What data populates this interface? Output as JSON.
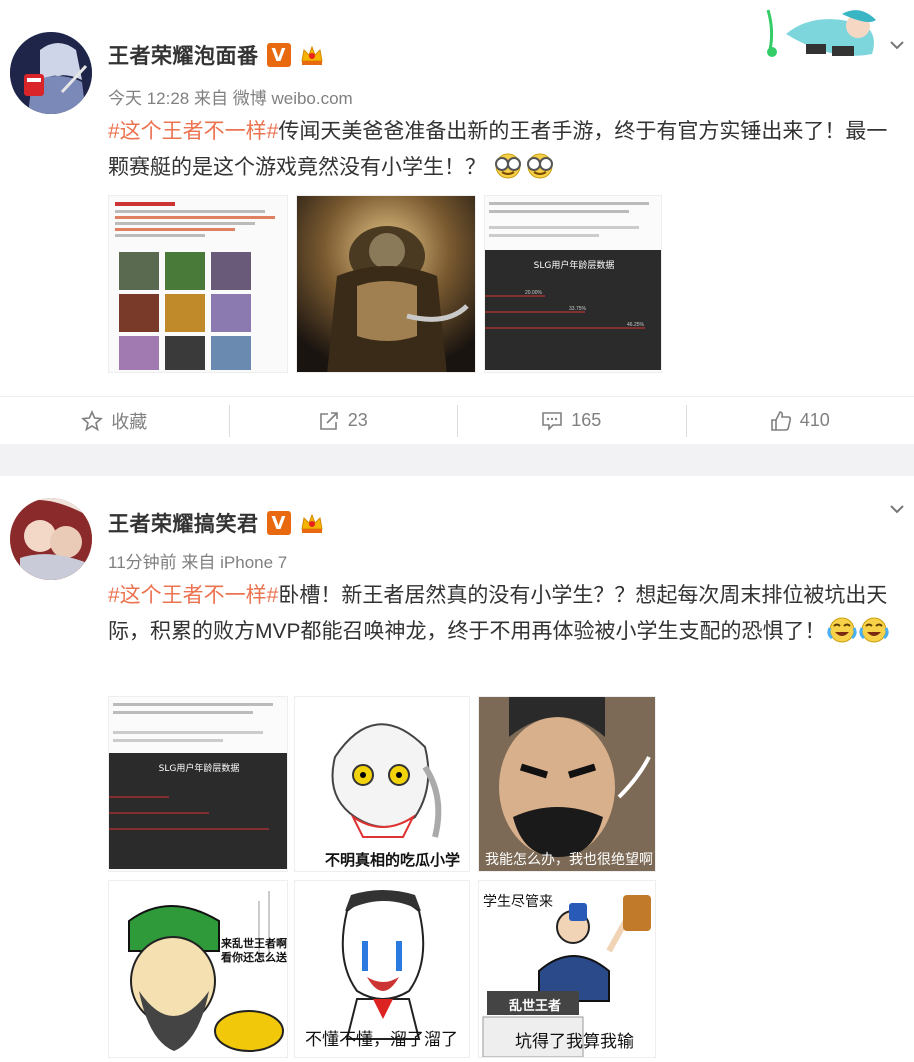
{
  "posts": [
    {
      "user_name": "王者荣耀泡面番",
      "verified_badge": "V",
      "time": "今天 12:28",
      "source_prefix": "来自",
      "source": "微博 weibo.com",
      "hashtag": "#这个王者不一样#",
      "text": "传闻天美爸爸准备出新的王者手游，终于有官方实锤出来了！最一颗赛艇的是这个游戏竟然没有小学生！？",
      "emojis": [
        "smile-glasses-emoji",
        "smile-glasses-emoji"
      ],
      "images": [
        {
          "name": "screenshot-weibo-grid-thumb"
        },
        {
          "name": "golden-armor-warrior-thumb"
        },
        {
          "name": "slg-chart-thumb",
          "chart_title": "SLG用户年龄层数据",
          "chart_labels": [
            "20.00%",
            "33.75%",
            "46.25%"
          ]
        }
      ],
      "actions": {
        "favorite_label": "收藏",
        "repost_count": "23",
        "comment_count": "165",
        "like_count": "410"
      }
    },
    {
      "user_name": "王者荣耀搞笑君",
      "verified_badge": "V",
      "time": "11分钟前",
      "source_prefix": "来自",
      "source": "iPhone 7",
      "hashtag": "#这个王者不一样#",
      "text": "卧槽！新王者居然真的没有小学生？？想起每次周末排位被坑出天际，积累的败方MVP都能召唤神龙，终于不用再体验被小学生支配的恐惧了！",
      "emojis": [
        "laugh-cry-emoji",
        "laugh-cry-emoji"
      ],
      "images": [
        {
          "name": "slg-chart-thumb",
          "chart_title": "SLG用户年龄层数据"
        },
        {
          "name": "meme-cartoon-thumb",
          "caption": "不明真相的吃瓜小学生"
        },
        {
          "name": "meme-face-thumb",
          "caption": "我能怎么办，我也很绝望啊"
        },
        {
          "name": "meme-general-thumb",
          "caption": "来乱世王者啊 看你还怎么送"
        },
        {
          "name": "meme-crying-thumb",
          "caption": "不懂不懂，溜了溜了"
        },
        {
          "name": "meme-podium-thumb",
          "caption_top": "学生尽管来",
          "sign": "乱世王者",
          "caption": "坑得了我算我输"
        }
      ]
    }
  ],
  "colors": {
    "hashtag": "#eb7350",
    "verified": "#e8690f",
    "meta": "#808080",
    "divider_band": "#f2f2f5"
  }
}
